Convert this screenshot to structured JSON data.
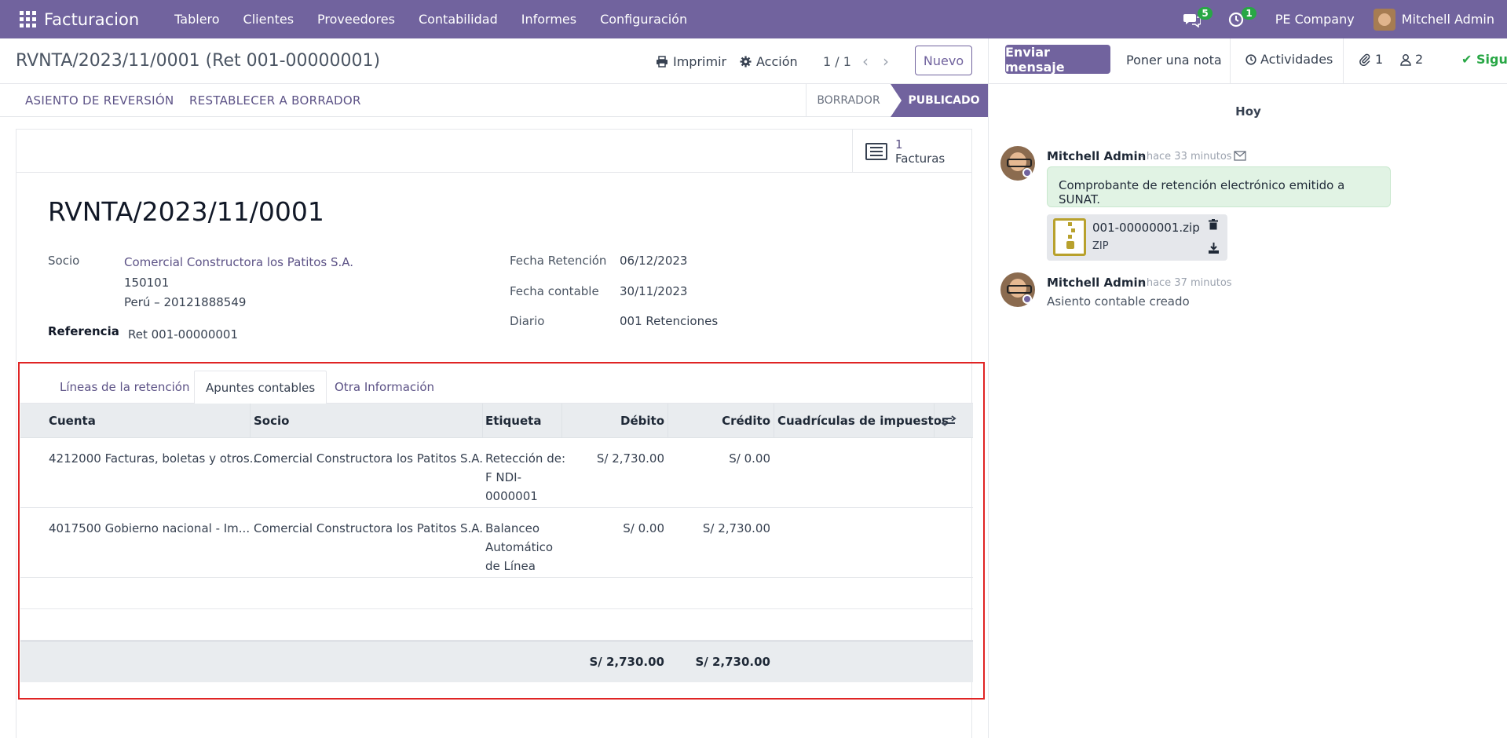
{
  "navbar": {
    "app_name": "Facturacion",
    "menu": [
      "Tablero",
      "Clientes",
      "Proveedores",
      "Contabilidad",
      "Informes",
      "Configuración"
    ],
    "messages_count": "5",
    "activities_count": "1",
    "company": "PE Company",
    "user": "Mitchell Admin",
    "color": "#71639e"
  },
  "control": {
    "breadcrumb": "RVNTA/2023/11/0001 (Ret 001-00000001)",
    "print_label": "Imprimir",
    "action_label": "Acción",
    "pager": "1 / 1",
    "new_label": "Nuevo"
  },
  "statusbar": {
    "reverse_label": "ASIENTO DE REVERSIÓN",
    "reset_label": "RESTABLECER A BORRADOR",
    "stage_draft": "BORRADOR",
    "stage_posted": "PUBLICADO"
  },
  "smart_button": {
    "value": "1",
    "label": "Facturas"
  },
  "form": {
    "title": "RVNTA/2023/11/0001",
    "partner_label": "Socio",
    "partner_name": "Comercial Constructora los Patitos S.A.",
    "partner_line2": "150101",
    "partner_line3": "Perú – 20121888549",
    "ref_label": "Referencia",
    "ref_value": "Ret 001-00000001",
    "ret_date_label": "Fecha Retención",
    "ret_date_value": "06/12/2023",
    "acc_date_label": "Fecha contable",
    "acc_date_value": "30/11/2023",
    "journal_label": "Diario",
    "journal_value": "001 Retenciones"
  },
  "tabs": [
    "Líneas de la retención",
    "Apuntes contables",
    "Otra Información"
  ],
  "table": {
    "headers": [
      "Cuenta",
      "Socio",
      "Etiqueta",
      "Débito",
      "Crédito",
      "Cuadrículas de impuestos"
    ],
    "rows": [
      {
        "account": "4212000 Facturas, boletas y otros...",
        "partner": "Comercial Constructora los Patitos S.A.",
        "label_lines": [
          "Retección de:",
          "F NDI-",
          "0000001"
        ],
        "debit": "S/ 2,730.00",
        "credit": "S/ 0.00"
      },
      {
        "account": "4017500 Gobierno nacional - Im...",
        "partner": "Comercial Constructora los Patitos S.A.",
        "label_lines": [
          "Balanceo",
          "Automático",
          "de Línea"
        ],
        "debit": "S/ 0.00",
        "credit": "S/ 2,730.00"
      }
    ],
    "total_debit": "S/ 2,730.00",
    "total_credit": "S/ 2,730.00"
  },
  "chatter": {
    "send_label": "Enviar mensaje",
    "note_label": "Poner una nota",
    "activities_label": "Actividades",
    "attachments_count": "1",
    "followers_count": "2",
    "follow_label": "Siguiendo",
    "today_label": "Hoy",
    "messages": [
      {
        "author": "Mitchell Admin",
        "when": "- hace 33 minutos",
        "body": "Comprobante de retención electrónico emitido a SUNAT.",
        "attachment_name": "001-00000001.zip",
        "attachment_ext": "ZIP"
      },
      {
        "author": "Mitchell Admin",
        "when": "- hace 37 minutos",
        "body": "Asiento contable creado"
      }
    ]
  }
}
